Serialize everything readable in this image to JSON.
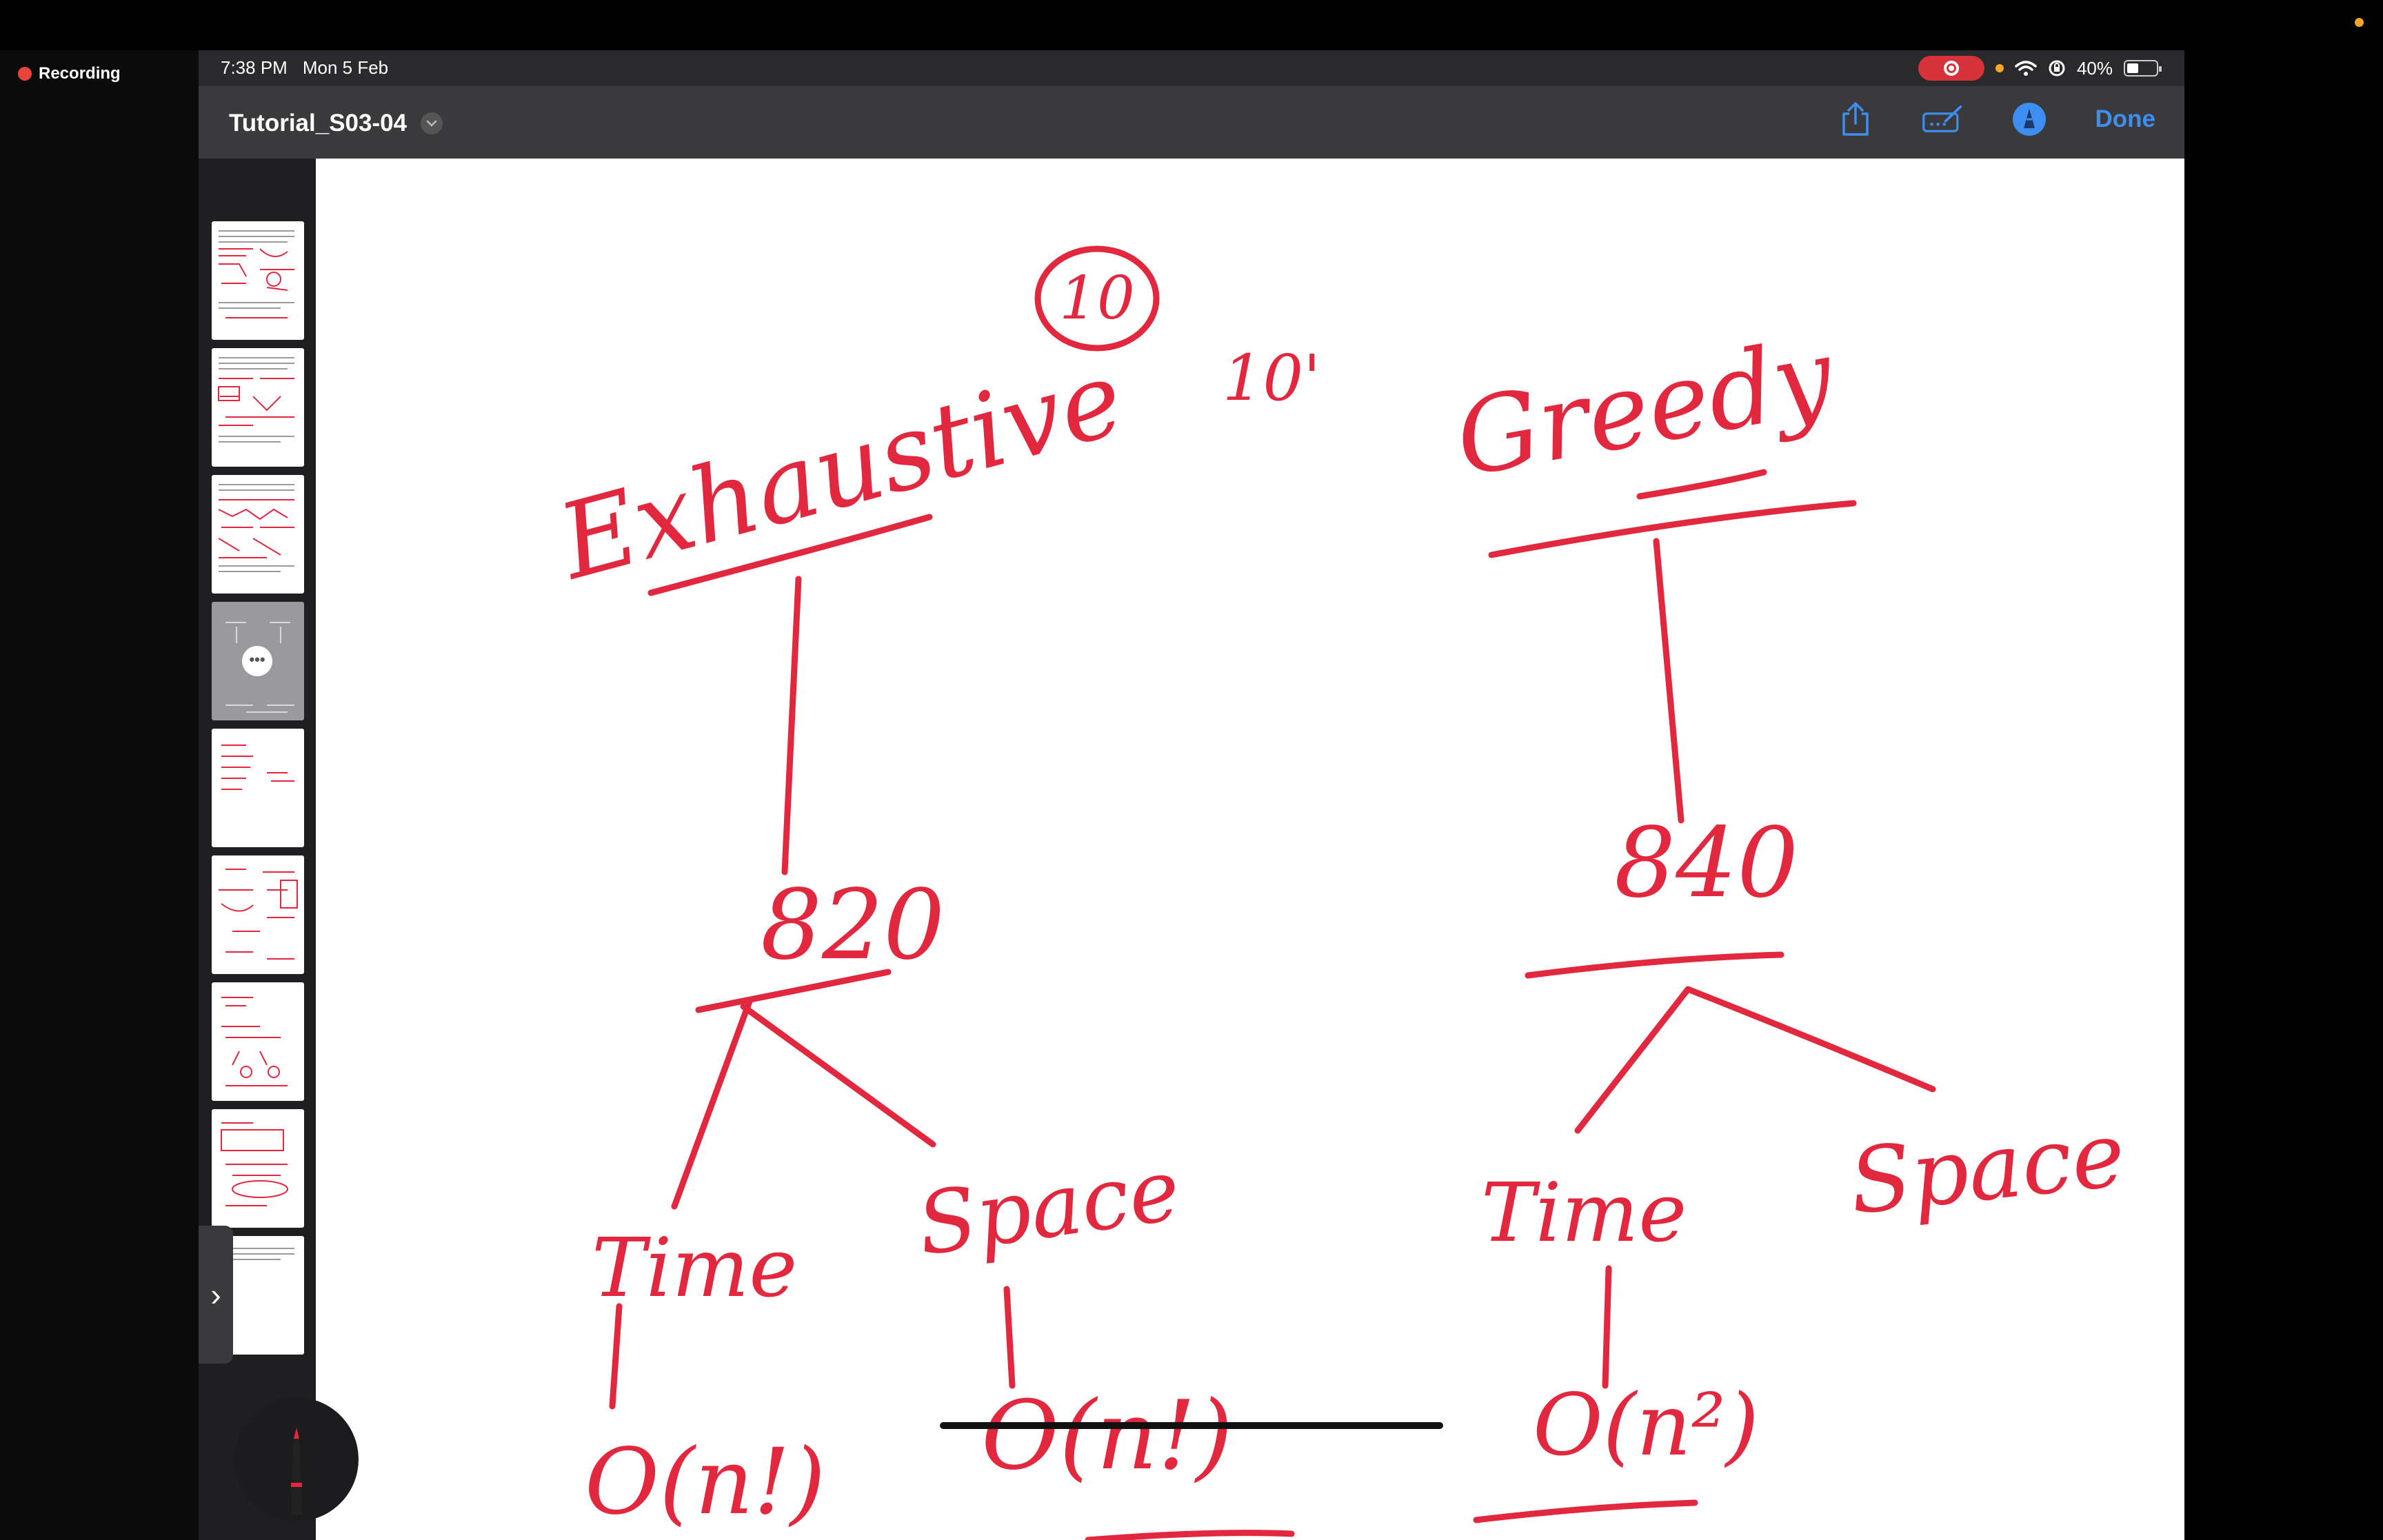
{
  "recording": {
    "label": "Recording"
  },
  "status": {
    "time": "7:38 PM",
    "date": "Mon 5 Feb",
    "battery": "40%"
  },
  "toolbar": {
    "title": "Tutorial_S03-04",
    "done_label": "Done"
  },
  "sidebar": {
    "handle_glyph": "›",
    "more_glyph": "•••",
    "thumbnail_count": 9,
    "selected_thumbnail": 4
  },
  "canvas": {
    "ink_color": "#e1283f",
    "notes": {
      "circled_number": "10",
      "minutes": "10'",
      "left_heading": "Exhaustive",
      "left_score": "820",
      "left_time": "Time",
      "left_space": "Space",
      "left_time_complexity": "O(n!)",
      "left_space_complexity": "O(n!)",
      "right_heading": "Greedy",
      "right_score": "840",
      "right_time": "Time",
      "right_space": "Space",
      "right_time_complexity": "O(n²)"
    }
  },
  "colors": {
    "accent": "#3d8ef0",
    "record": "#d6323a",
    "toolbar": "#3a3a3c"
  },
  "icons": [
    "share-icon",
    "markup-icon",
    "pencil-tip-icon",
    "chevron-down-icon",
    "wifi-icon",
    "battery-icon"
  ]
}
